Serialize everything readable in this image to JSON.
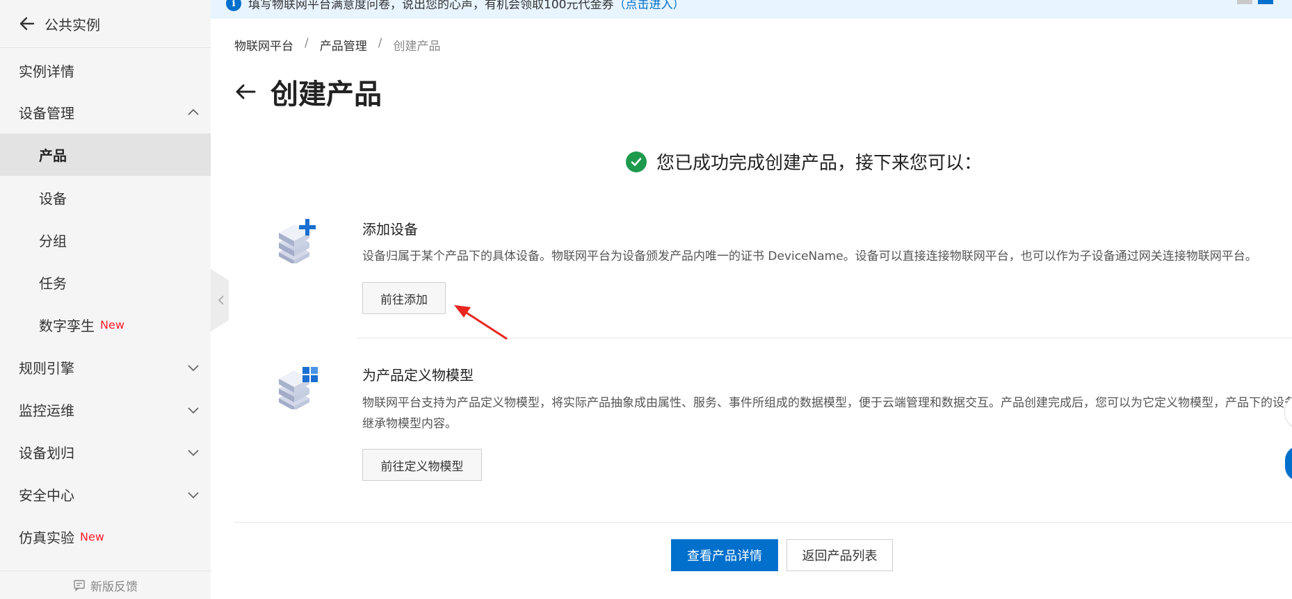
{
  "sidebar": {
    "header_title": "公共实例",
    "items": [
      {
        "label": "实例详情",
        "tag": ""
      },
      {
        "label": "设备管理",
        "tag": ""
      },
      {
        "label": "产品",
        "tag": ""
      },
      {
        "label": "设备",
        "tag": ""
      },
      {
        "label": "分组",
        "tag": ""
      },
      {
        "label": "任务",
        "tag": ""
      },
      {
        "label": "数字孪生",
        "tag": "New"
      },
      {
        "label": "规则引擎",
        "tag": ""
      },
      {
        "label": "监控运维",
        "tag": ""
      },
      {
        "label": "设备划归",
        "tag": ""
      },
      {
        "label": "安全中心",
        "tag": ""
      },
      {
        "label": "仿真实验",
        "tag": "New"
      }
    ],
    "footer_label": "新版反馈"
  },
  "banner": {
    "text": "填写物联网平台满意度问卷，说出您的心声，有机会领取100元代金券",
    "link": "（点击进入）"
  },
  "breadcrumb": [
    "物联网平台",
    "产品管理",
    "创建产品"
  ],
  "page_title": "创建产品",
  "success_message": "您已成功完成创建产品，接下来您可以：",
  "cards": [
    {
      "title": "添加设备",
      "description": "设备归属于某个产品下的具体设备。物联网平台为设备颁发产品内唯一的证书 DeviceName。设备可以直接连接物联网平台，也可以作为子设备通过网关连接物联网平台。",
      "button": "前往添加"
    },
    {
      "title": "为产品定义物模型",
      "description": "物联网平台支持为产品定义物模型，将实际产品抽象成由属性、服务、事件所组成的数据模型，便于云端管理和数据交互。产品创建完成后，您可以为它定义物模型，产品下的设备将自动继承物模型内容。",
      "button": "前往定义物模型"
    }
  ],
  "actions": {
    "primary": "查看产品详情",
    "secondary": "返回产品列表"
  },
  "colors": {
    "primary": "#0070cc",
    "success": "#1e9a4c",
    "new_tag": "#ff1d2c",
    "annotation_arrow": "#e8261f"
  }
}
